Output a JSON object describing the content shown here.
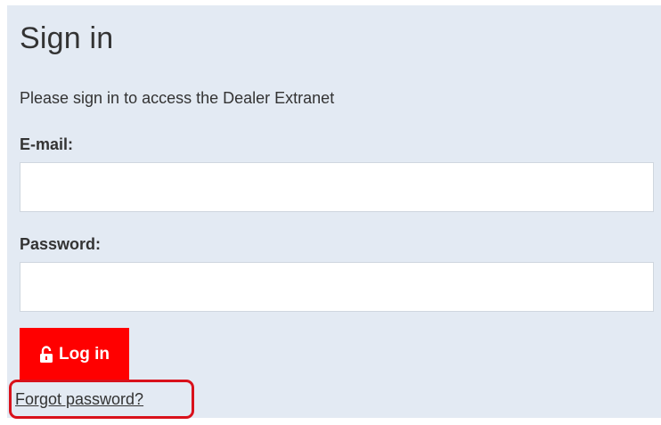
{
  "signin": {
    "title": "Sign in",
    "subtitle": "Please sign in to access the Dealer Extranet",
    "email_label": "E-mail:",
    "email_value": "",
    "password_label": "Password:",
    "password_value": "",
    "login_button_label": "Log in",
    "login_icon": "unlock-icon",
    "forgot_link": "Forgot password?"
  },
  "colors": {
    "panel_bg": "#e3eaf3",
    "button_bg": "#ff0000",
    "highlight_border": "#d9111b",
    "text": "#333333"
  }
}
